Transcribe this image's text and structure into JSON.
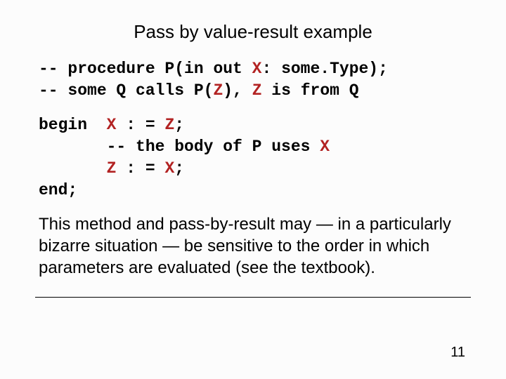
{
  "title": "Pass by value-result example",
  "code": {
    "l1a": "-- procedure P(in out ",
    "l1b": "X",
    "l1c": ": some.Type);",
    "l2a": "-- some Q calls P(",
    "l2b": "Z",
    "l2c": "), ",
    "l2d": "Z",
    "l2e": " is from Q",
    "l3a": "begin",
    "l3b": "  ",
    "l3c": "X",
    "l3d": " : = ",
    "l3e": "Z",
    "l3f": ";",
    "l4a": "       -- the body of P uses ",
    "l4b": "X",
    "l5a": "       ",
    "l5b": "Z",
    "l5c": " : = ",
    "l5d": "X",
    "l5e": ";",
    "l6": "end;"
  },
  "body": "This method and pass-by-result may — in a particularly bizarre situation — be sensitive to the order in which parameters are evaluated (see the textbook).",
  "page_number": "11"
}
